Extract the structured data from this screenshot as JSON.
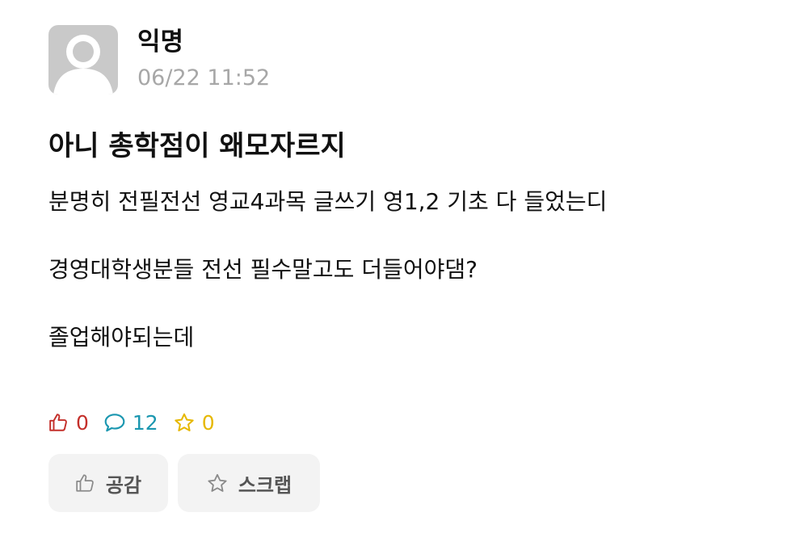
{
  "post": {
    "author": "익명",
    "time": "06/22 11:52",
    "title": "아니 총학점이 왜모자르지",
    "body": [
      "분명히 전필전선 영교4과목 글쓰기 영1,2 기초 다 들었는디",
      "경영대학생분들 전선 필수말고도 더들어야댐?",
      "졸업해야되는데"
    ]
  },
  "stats": {
    "likes": "0",
    "comments": "12",
    "scraps": "0"
  },
  "actions": {
    "like_label": "공감",
    "scrap_label": "스크랩"
  },
  "icons": {
    "like": "thumbs-up-icon",
    "comment": "speech-bubble-icon",
    "scrap": "star-icon"
  },
  "colors": {
    "like": "#c4302b",
    "comment": "#1b97b0",
    "scrap": "#e6b800",
    "timestamp": "#a7a7a7",
    "avatar": "#c9c9c9",
    "button_bg": "#f3f3f3"
  }
}
